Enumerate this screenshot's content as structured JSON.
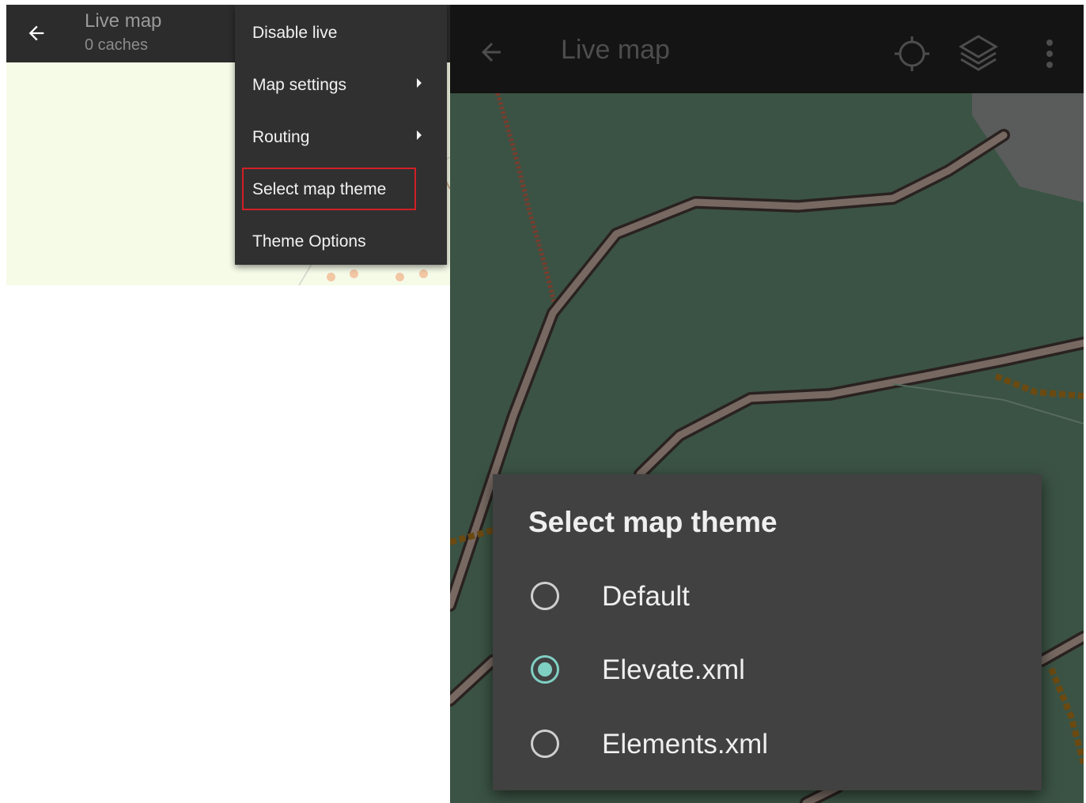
{
  "left_panel": {
    "toolbar": {
      "title": "Live map",
      "subtitle": "0 caches",
      "back_icon": "arrow-left-icon"
    },
    "overflow_menu": {
      "items": [
        {
          "label": "Disable live",
          "has_submenu": false
        },
        {
          "label": "Map settings",
          "has_submenu": true
        },
        {
          "label": "Routing",
          "has_submenu": true
        },
        {
          "label": "Select map theme",
          "has_submenu": false,
          "highlighted": true
        },
        {
          "label": "Theme Options",
          "has_submenu": false
        }
      ],
      "highlight_color": "#d21f26"
    }
  },
  "right_panel": {
    "toolbar": {
      "title": "Live map",
      "icons": [
        "arrow-left-icon",
        "gps-crosshair-icon",
        "layers-icon",
        "more-vert-icon"
      ]
    },
    "dialog": {
      "title": "Select map theme",
      "options": [
        {
          "label": "Default",
          "selected": false
        },
        {
          "label": "Elevate.xml",
          "selected": true
        },
        {
          "label": "Elements.xml",
          "selected": false
        }
      ],
      "accent_color": "#7fcfc3"
    }
  }
}
